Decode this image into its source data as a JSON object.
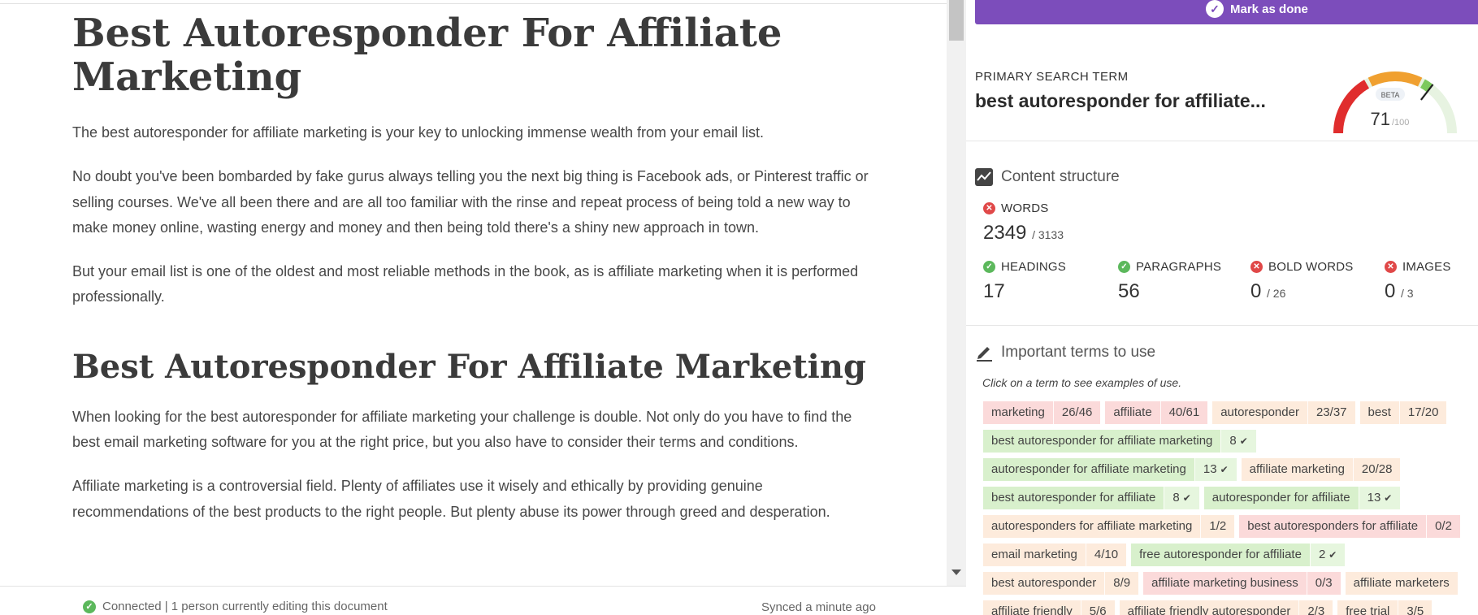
{
  "editor": {
    "title": "Best Autoresponder For Affiliate Marketing",
    "paragraphs_top": [
      "The best autoresponder for affiliate marketing is your key to unlocking immense wealth from your email list.",
      "No doubt you've been bombarded by fake gurus always telling you the next big thing is Facebook ads, or Pinterest traffic or selling courses. We've all been there and are all too familiar with the rinse and repeat process of being told a new way to make money online, wasting energy and money and then being told there's a shiny new approach in town.",
      "But your email list is one of the oldest and most reliable methods in the book, as is affiliate marketing when it is performed professionally."
    ],
    "heading2": "Best Autoresponder For Affiliate Marketing",
    "paragraphs_bottom": [
      "When looking for the best autoresponder for affiliate marketing your challenge is double. Not only do you have to find the best email marketing software for you at the right price, but you also have to consider their terms and conditions.",
      "Affiliate marketing is a controversial field. Plenty of affiliates use it wisely and ethically by providing genuine recommendations of the best products to the right people. But plenty abuse its power through greed and desperation."
    ],
    "status": {
      "connected": "Connected | 1 person currently editing this document",
      "synced": "Synced a minute ago"
    }
  },
  "sidebar": {
    "mark_done_label": "Mark as done",
    "primary_search_term_label": "PRIMARY SEARCH TERM",
    "primary_search_term": "best autoresponder for affiliate...",
    "score": {
      "badge": "BETA",
      "value": "71",
      "max": "/100",
      "fraction": 0.71
    },
    "content_structure": {
      "title": "Content structure",
      "words": {
        "label": "WORDS",
        "value": "2349",
        "target": "/ 3133",
        "status": "bad"
      },
      "headings": {
        "label": "HEADINGS",
        "value": "17",
        "status": "good"
      },
      "paragraphs": {
        "label": "PARAGRAPHS",
        "value": "56",
        "status": "good"
      },
      "bold_words": {
        "label": "BOLD WORDS",
        "value": "0",
        "target": "/ 26",
        "status": "bad"
      },
      "images": {
        "label": "IMAGES",
        "value": "0",
        "target": "/ 3",
        "status": "bad"
      }
    },
    "terms": {
      "title": "Important terms to use",
      "hint": "Click on a term to see examples of use.",
      "rows": [
        [
          {
            "term": "marketing",
            "count": "26/46",
            "status": "red"
          },
          {
            "term": "affiliate",
            "count": "40/61",
            "status": "red"
          },
          {
            "term": "autoresponder",
            "count": "23/37",
            "status": "orange"
          },
          {
            "term": "best",
            "count": "17/20",
            "status": "orange"
          }
        ],
        [
          {
            "term": "best autoresponder for affiliate marketing",
            "count": "8",
            "status": "green"
          }
        ],
        [
          {
            "term": "autoresponder for affiliate marketing",
            "count": "13",
            "status": "green"
          },
          {
            "term": "affiliate marketing",
            "count": "20/28",
            "status": "orange"
          }
        ],
        [
          {
            "term": "best autoresponder for affiliate",
            "count": "8",
            "status": "green"
          },
          {
            "term": "autoresponder for affiliate",
            "count": "13",
            "status": "green"
          }
        ],
        [
          {
            "term": "autoresponders for affiliate marketing",
            "count": "1/2",
            "status": "orange"
          },
          {
            "term": "best autoresponders for affiliate",
            "count": "0/2",
            "status": "red"
          }
        ],
        [
          {
            "term": "email marketing",
            "count": "4/10",
            "status": "orange"
          },
          {
            "term": "free autoresponder for affiliate",
            "count": "2",
            "status": "green"
          }
        ],
        [
          {
            "term": "best autoresponder",
            "count": "8/9",
            "status": "orange"
          },
          {
            "term": "affiliate marketing business",
            "count": "0/3",
            "status": "red"
          },
          {
            "term": "affiliate marketers",
            "count": "",
            "status": "orange"
          }
        ],
        [
          {
            "term": "affiliate friendly",
            "count": "5/6",
            "status": "orange"
          },
          {
            "term": "affiliate friendly autoresponder",
            "count": "2/3",
            "status": "orange"
          },
          {
            "term": "free trial",
            "count": "3/5",
            "status": "orange"
          }
        ]
      ]
    },
    "colors": {
      "accent": "#7c4dbb",
      "good": "#5cb85c",
      "bad": "#e04848",
      "gauge_red": "#e02d2d",
      "gauge_orange": "#f0a030",
      "gauge_green": "#7cc95c"
    }
  }
}
